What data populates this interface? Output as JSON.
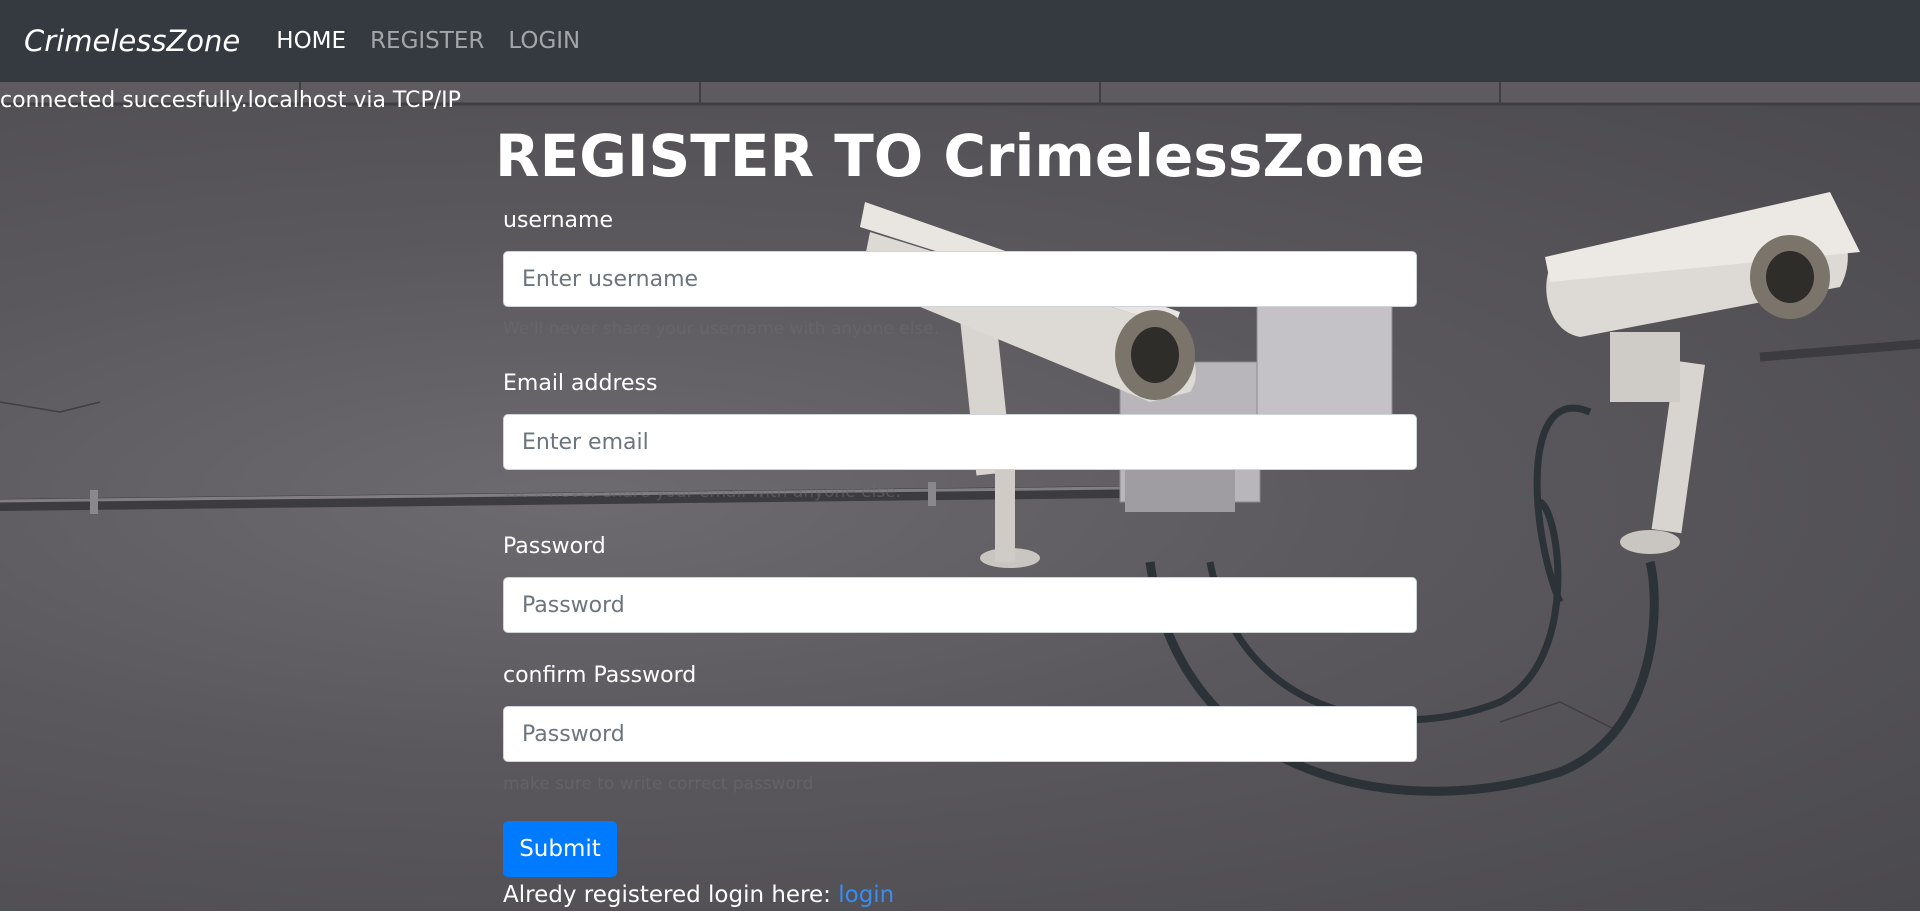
{
  "navbar": {
    "brand": "CrimelessZone",
    "links": [
      "HOME",
      "REGISTER",
      "LOGIN"
    ]
  },
  "status_message": "connected succesfully.localhost via TCP/IP",
  "page_title": "REGISTER TO CrimelessZone",
  "form": {
    "username": {
      "label": "username",
      "placeholder": "Enter username",
      "help": "We'll never share your username with anyone else."
    },
    "email": {
      "label": "Email address",
      "placeholder": "Enter email",
      "help": "We'll never share your email with anyone else."
    },
    "password": {
      "label": "Password",
      "placeholder": "Password"
    },
    "confirm_password": {
      "label": "confirm Password",
      "placeholder": "Password",
      "help": "make sure to write correct password"
    },
    "submit_label": "Submit"
  },
  "login_prompt": {
    "text": "Alredy registered login here: ",
    "link": "login"
  },
  "colors": {
    "navbar_bg": "#343a40",
    "button_primary": "#007bff",
    "link": "#3b8cf0"
  }
}
